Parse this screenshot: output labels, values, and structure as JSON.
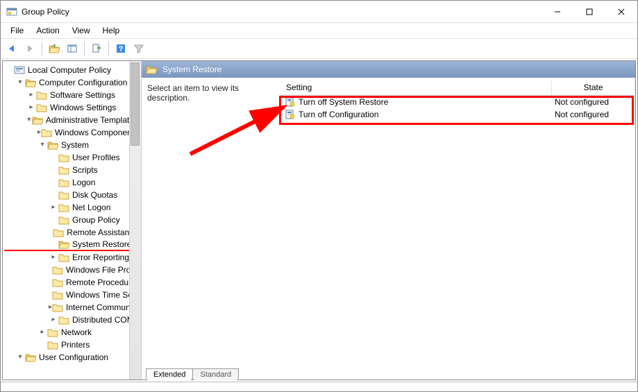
{
  "window": {
    "title": "Group Policy"
  },
  "menu": {
    "file": "File",
    "action": "Action",
    "view": "View",
    "help": "Help"
  },
  "tree": {
    "root": "Local Computer Policy",
    "comp_cfg": "Computer Configuration",
    "software": "Software Settings",
    "windows_settings": "Windows Settings",
    "admin_templates": "Administrative Templates",
    "win_components": "Windows Components",
    "system": "System",
    "user_profiles": "User Profiles",
    "scripts": "Scripts",
    "logon": "Logon",
    "disk_quotas": "Disk Quotas",
    "net_logon": "Net Logon",
    "group_policy": "Group Policy",
    "remote_assis": "Remote Assistance",
    "system_restore": "System Restore",
    "error_reporting": "Error Reporting",
    "windows_file": "Windows File Protection",
    "remote_proc": "Remote Procedure Call",
    "windows_time": "Windows Time Service",
    "internet_com": "Internet Communication Management",
    "distributed_c": "Distributed COM",
    "network": "Network",
    "printers": "Printers",
    "user_cfg": "User Configuration"
  },
  "detail": {
    "header": "System Restore",
    "prompt": "Select an item to view its description.",
    "columns": {
      "setting": "Setting",
      "state": "State"
    },
    "rows": [
      {
        "setting": "Turn off System Restore",
        "state": "Not configured"
      },
      {
        "setting": "Turn off Configuration",
        "state": "Not configured"
      }
    ]
  },
  "tabs": {
    "extended": "Extended",
    "standard": "Standard"
  }
}
